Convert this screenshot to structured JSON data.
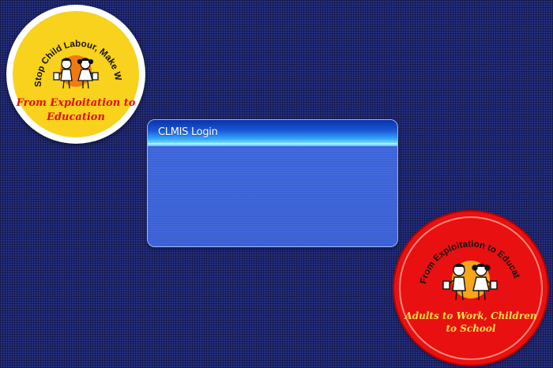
{
  "login": {
    "title": "CLMIS Login"
  },
  "badges": {
    "yellow": {
      "arc_text": "Stop Child Labour, Make Way for Education",
      "slogan": "From Exploitation to Education"
    },
    "red": {
      "arc_text": "From Exploitation to Education",
      "slogan": "Adults to Work, Children to School"
    }
  },
  "colors": {
    "background": "#26307e",
    "yellow_badge": "#f8d21c",
    "red_badge": "#e81010",
    "panel_body": "#3d66dc"
  }
}
